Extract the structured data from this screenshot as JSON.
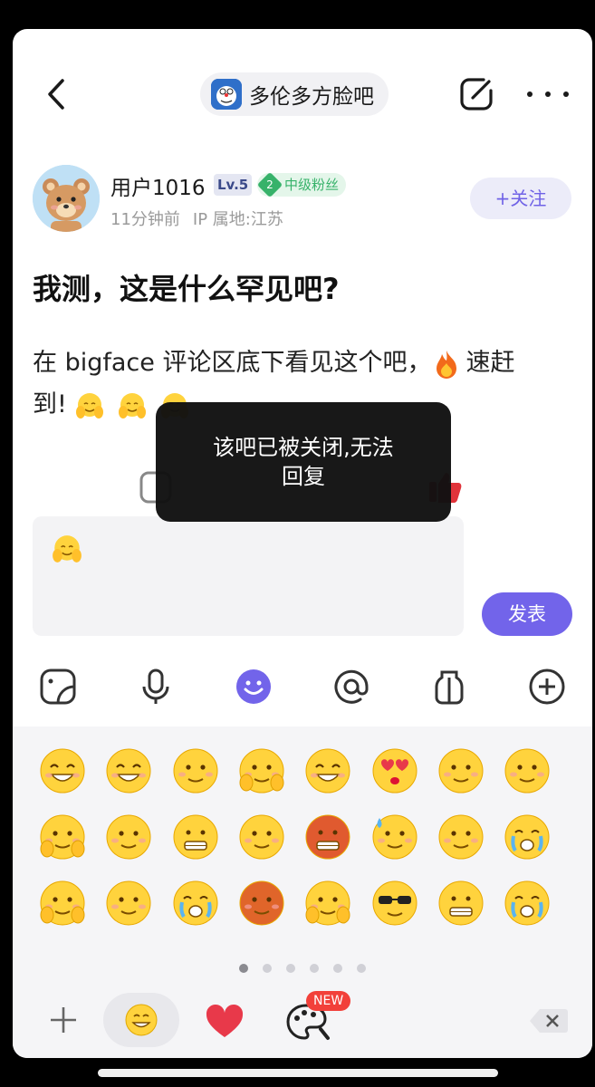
{
  "header": {
    "forum_name": "多伦多方脸吧"
  },
  "author": {
    "name": "用户1016",
    "level": "Lv.5",
    "fan_level_number": "2",
    "fan_badge": "中级粉丝",
    "time": "11分钟前",
    "ip_location": "IP 属地:江苏",
    "follow_label": "+关注"
  },
  "post": {
    "title": "我测，这是什么罕见吧?",
    "body_line1": "在 bigface 评论区底下看见这个吧，",
    "body_line2_a": "速赶",
    "body_line2_b": "到!"
  },
  "reply": {
    "send_label": "发表"
  },
  "toast": {
    "line1": "该吧已被关闭,无法",
    "line2": "回复"
  },
  "bottom_tabs": {
    "new_badge": "NEW"
  },
  "emoji_panel": {
    "page_count": 6,
    "active_page": 1
  },
  "colors": {
    "accent": "#7264ea",
    "fan_green": "#37b26a",
    "emoji_yellow": "#ffd33d"
  }
}
